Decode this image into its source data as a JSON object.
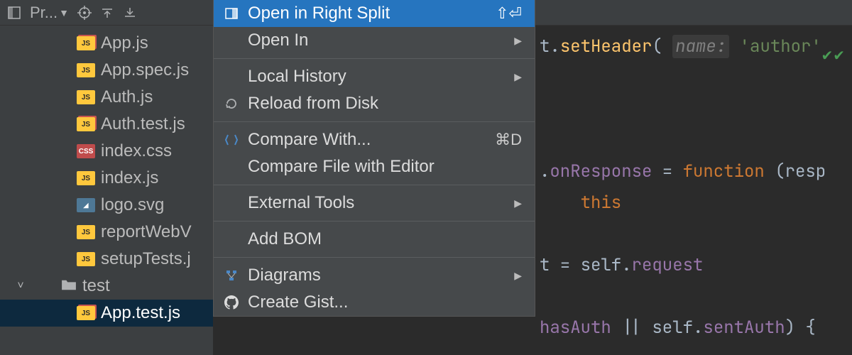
{
  "toolbar": {
    "project_label": "Pr...",
    "icons": [
      "target-icon",
      "collapse-all-icon",
      "expand-all-icon"
    ]
  },
  "sidebar": {
    "items": [
      {
        "name": "App.js",
        "icon": "js",
        "test_badge": true
      },
      {
        "name": "App.spec.js",
        "icon": "js",
        "test_badge": false
      },
      {
        "name": "Auth.js",
        "icon": "js",
        "test_badge": false
      },
      {
        "name": "Auth.test.js",
        "icon": "js",
        "test_badge": true
      },
      {
        "name": "index.css",
        "icon": "css",
        "test_badge": false
      },
      {
        "name": "index.js",
        "icon": "js",
        "test_badge": false
      },
      {
        "name": "logo.svg",
        "icon": "svg",
        "test_badge": false
      },
      {
        "name": "reportWebV",
        "icon": "js",
        "test_badge": false
      },
      {
        "name": "setupTests.j",
        "icon": "js",
        "test_badge": false
      }
    ],
    "folder": {
      "name": "test",
      "expanded": true
    },
    "selected_file": "App.test.js"
  },
  "context_menu": {
    "groups": [
      [
        {
          "label": "Open in Right Split",
          "shortcut": "⇧⏎",
          "icon": "split-right-icon",
          "highlighted": true,
          "submenu": false
        },
        {
          "label": "Open In",
          "shortcut": "",
          "icon": "",
          "highlighted": false,
          "submenu": true
        }
      ],
      [
        {
          "label": "Local History",
          "shortcut": "",
          "icon": "",
          "highlighted": false,
          "submenu": true
        },
        {
          "label": "Reload from Disk",
          "shortcut": "",
          "icon": "reload-icon",
          "highlighted": false,
          "submenu": false
        }
      ],
      [
        {
          "label": "Compare With...",
          "shortcut": "⌘D",
          "icon": "diff-icon",
          "highlighted": false,
          "submenu": false
        },
        {
          "label": "Compare File with Editor",
          "shortcut": "",
          "icon": "",
          "highlighted": false,
          "submenu": false
        }
      ],
      [
        {
          "label": "External Tools",
          "shortcut": "",
          "icon": "",
          "highlighted": false,
          "submenu": true
        }
      ],
      [
        {
          "label": "Add BOM",
          "shortcut": "",
          "icon": "",
          "highlighted": false,
          "submenu": false
        }
      ],
      [
        {
          "label": "Diagrams",
          "shortcut": "",
          "icon": "diagram-icon",
          "highlighted": false,
          "submenu": true
        },
        {
          "label": "Create Gist...",
          "shortcut": "",
          "icon": "github-icon",
          "highlighted": false,
          "submenu": false
        }
      ]
    ]
  },
  "editor": {
    "lines": [
      {
        "prefix": "t.",
        "method": "setHeader",
        "paren": "(",
        "hint": "name:",
        "tail_string": "'author'",
        "tail_punc": ""
      },
      {
        "blank": true
      },
      {
        "blank": true
      },
      {
        "blank": true
      },
      {
        "prefix": ".",
        "prop": "onResponse",
        "assign": " = ",
        "kw": "function",
        "tail_paren": " (resp"
      },
      {
        "indent": "    ",
        "kw_this": "this"
      },
      {
        "blank": true
      },
      {
        "prefix": "t = self.",
        "prop2": "request"
      },
      {
        "blank": true
      },
      {
        "prefix_prop": "hasAuth",
        "or": " || self.",
        "prop3": "sentAuth",
        "tail": ") {"
      }
    ]
  }
}
